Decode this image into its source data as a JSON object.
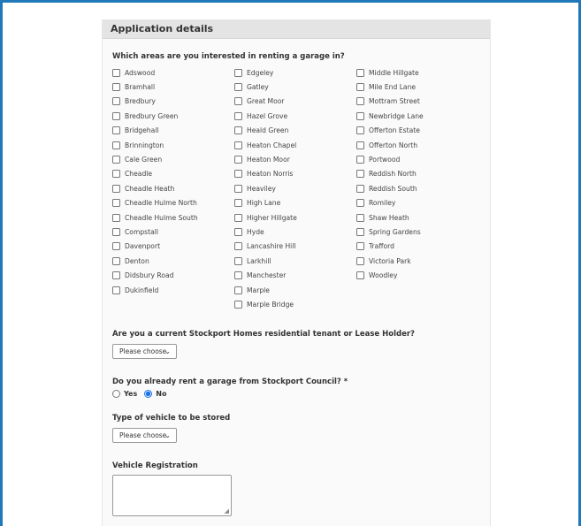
{
  "section": {
    "title": "Application details"
  },
  "areas": {
    "question": "Which areas are you interested in renting a garage in?",
    "columns": [
      [
        "Adswood",
        "Bramhall",
        "Bredbury",
        "Bredbury Green",
        "Bridgehall",
        "Brinnington",
        "Cale Green",
        "Cheadle",
        "Cheadle Heath",
        "Cheadle Hulme North",
        "Cheadle Hulme South",
        "Compstall",
        "Davenport",
        "Denton",
        "Didsbury Road",
        "Dukinfield"
      ],
      [
        "Edgeley",
        "Gatley",
        "Great Moor",
        "Hazel Grove",
        "Heald Green",
        "Heaton Chapel",
        "Heaton Moor",
        "Heaton Norris",
        "Heaviley",
        "High Lane",
        "Higher Hillgate",
        "Hyde",
        "Lancashire Hill",
        "Larkhill",
        "Manchester",
        "Marple",
        "Marple Bridge"
      ],
      [
        "Middle Hillgate",
        "Mile End Lane",
        "Mottram Street",
        "Newbridge Lane",
        "Offerton Estate",
        "Offerton North",
        "Portwood",
        "Reddish North",
        "Reddish South",
        "Romiley",
        "Shaw Heath",
        "Spring Gardens",
        "Trafford",
        "Victoria Park",
        "Woodley"
      ]
    ]
  },
  "tenant": {
    "question": "Are you a current Stockport Homes residential tenant or Lease Holder?",
    "select_value": "Please choose"
  },
  "rent_garage": {
    "question": "Do you already rent a garage from Stockport Council? *",
    "options": [
      {
        "label": "Yes",
        "selected": false
      },
      {
        "label": "No",
        "selected": true
      }
    ]
  },
  "vehicle_type": {
    "question": "Type of vehicle to be stored",
    "select_value": "Please choose"
  },
  "registration": {
    "label": "Vehicle Registration",
    "value": ""
  },
  "colors": {
    "frame": "#1f78b8",
    "header_bg": "#e4e4e4",
    "accent": "#1a73e8"
  },
  "icons": {
    "select_arrow": "chevron-down-icon",
    "resize": "resize-grip-icon"
  }
}
